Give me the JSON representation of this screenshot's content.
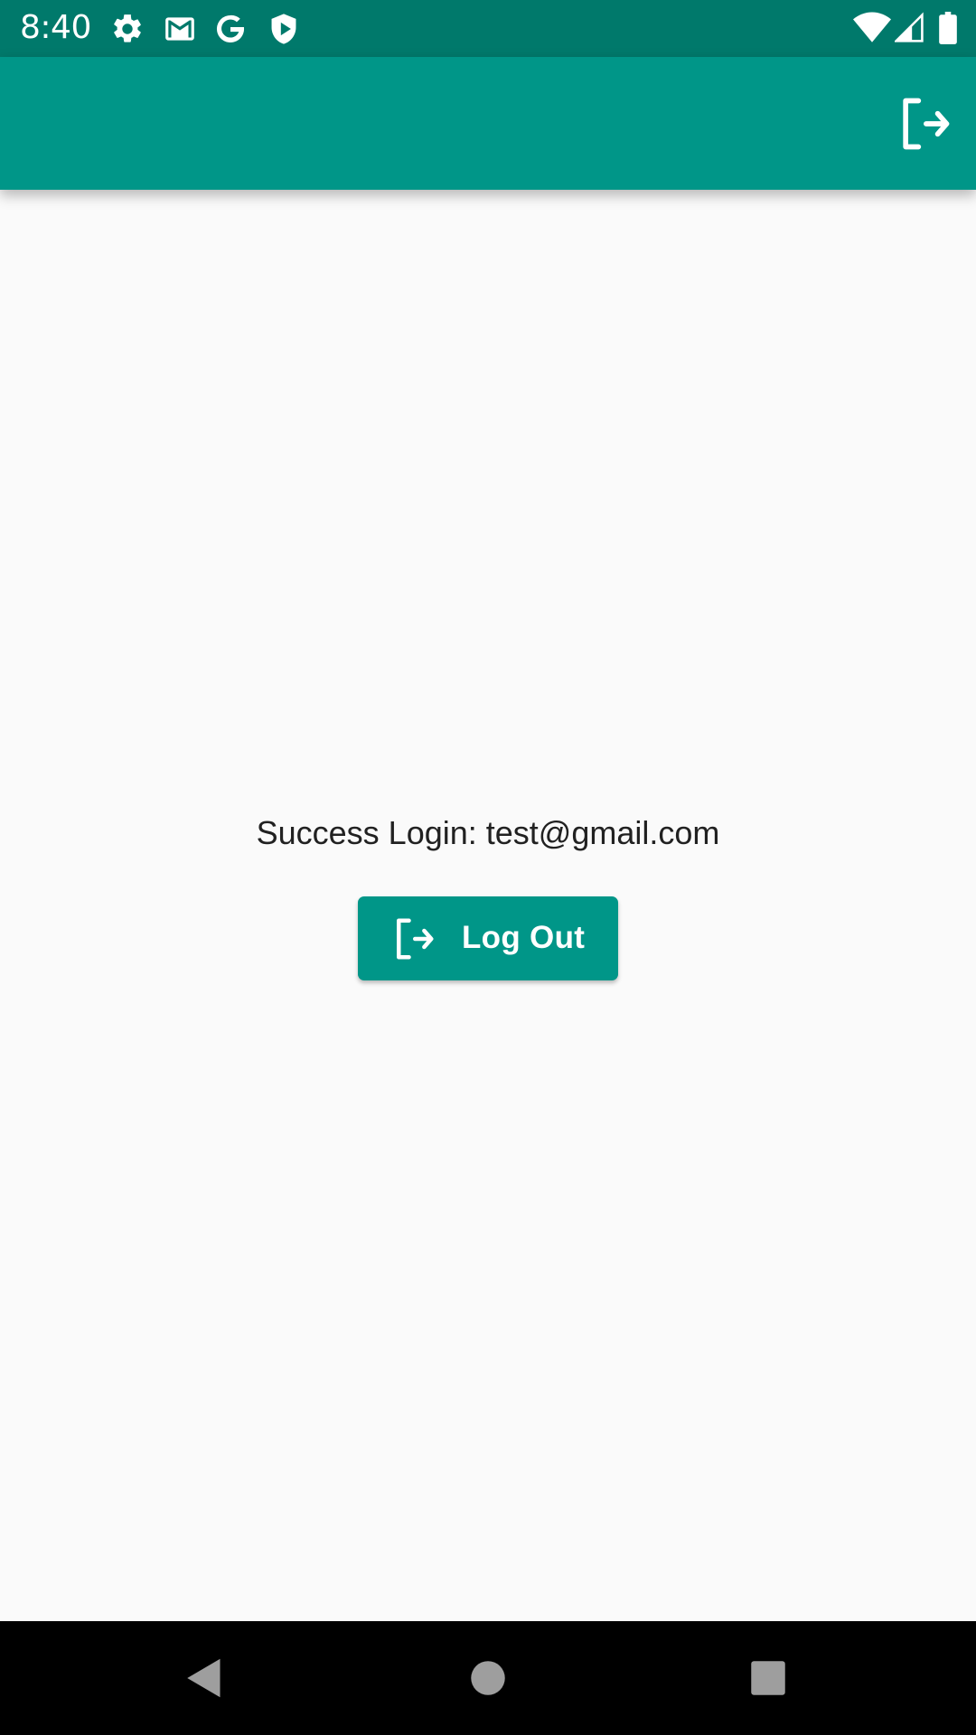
{
  "status_bar": {
    "time": "8:40",
    "left_icons": [
      "gear-icon",
      "gmail-icon",
      "google-icon",
      "shield-play-icon"
    ],
    "right_icons": [
      "wifi-icon",
      "cell-signal-icon",
      "battery-icon"
    ],
    "background": "#00796b"
  },
  "app_bar": {
    "background": "#009688",
    "action_icon": "logout-icon"
  },
  "main": {
    "success_message": "Success Login: test@gmail.com",
    "logout_button": {
      "label": "Log Out",
      "icon": "logout-icon",
      "background": "#009688"
    }
  },
  "nav_bar": {
    "buttons": [
      "back-icon",
      "home-icon",
      "recents-icon"
    ]
  }
}
